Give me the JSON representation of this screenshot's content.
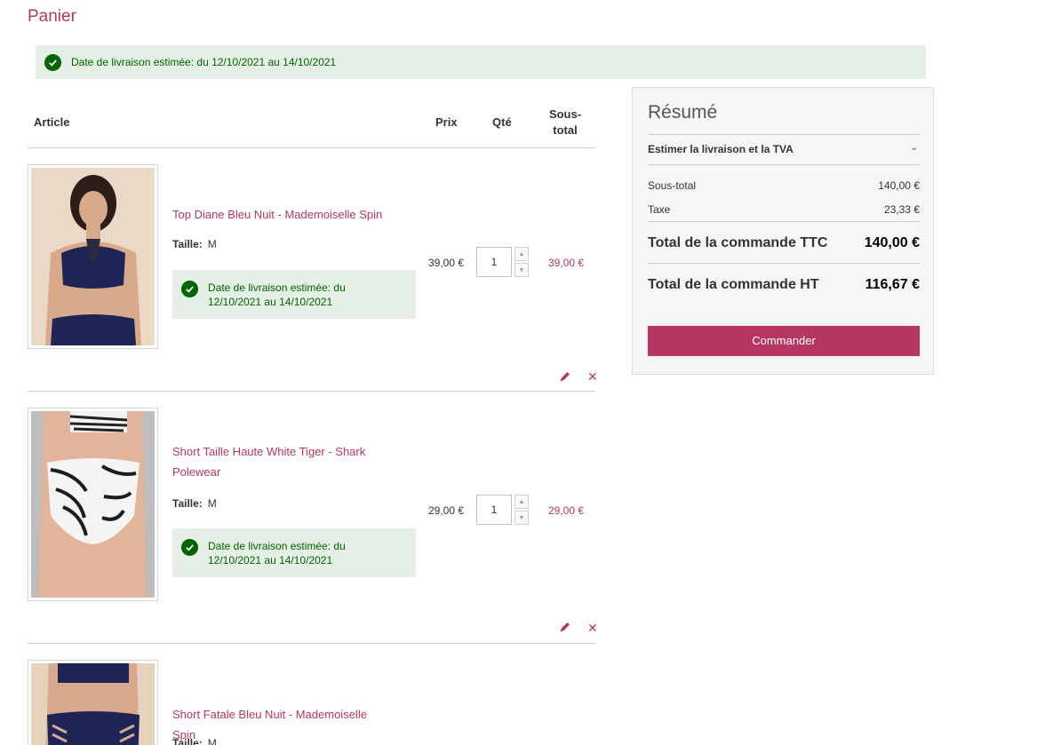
{
  "page": {
    "title": "Panier"
  },
  "banner": {
    "text": "Date de livraison estimée: du 12/10/2021 au 14/10/2021"
  },
  "table": {
    "headers": {
      "article": "Article",
      "price": "Prix",
      "qty": "Qté",
      "subtotal": "Sous-total"
    }
  },
  "items": [
    {
      "name": "Top Diane Bleu Nuit - Mademoiselle Spin",
      "size_label": "Taille:",
      "size_value": "M",
      "delivery": "Date de livraison estimée: du 12/10/2021 au 14/10/2021",
      "price": "39,00 €",
      "qty": "1",
      "subtotal": "39,00 €"
    },
    {
      "name": "Short Taille Haute White Tiger - Shark Polewear",
      "size_label": "Taille:",
      "size_value": "M",
      "delivery": "Date de livraison estimée: du 12/10/2021 au 14/10/2021",
      "price": "29,00 €",
      "qty": "1",
      "subtotal": "29,00 €"
    },
    {
      "name": "Short Fatale Bleu Nuit - Mademoiselle Spin",
      "size_label": "Taille:",
      "size_value": "M"
    }
  ],
  "summary": {
    "title": "Résumé",
    "estimate_label": "Estimer la livraison et la TVA",
    "subtotal_label": "Sous-total",
    "subtotal_value": "140,00 €",
    "tax_label": "Taxe",
    "tax_value": "23,33 €",
    "total_ttc_label": "Total de la commande TTC",
    "total_ttc_value": "140,00 €",
    "total_ht_label": "Total de la commande HT",
    "total_ht_value": "116,67 €",
    "checkout_label": "Commander"
  },
  "colors": {
    "accent": "#b5375f",
    "success_bg": "#e5efe5",
    "success_text": "#006400"
  }
}
